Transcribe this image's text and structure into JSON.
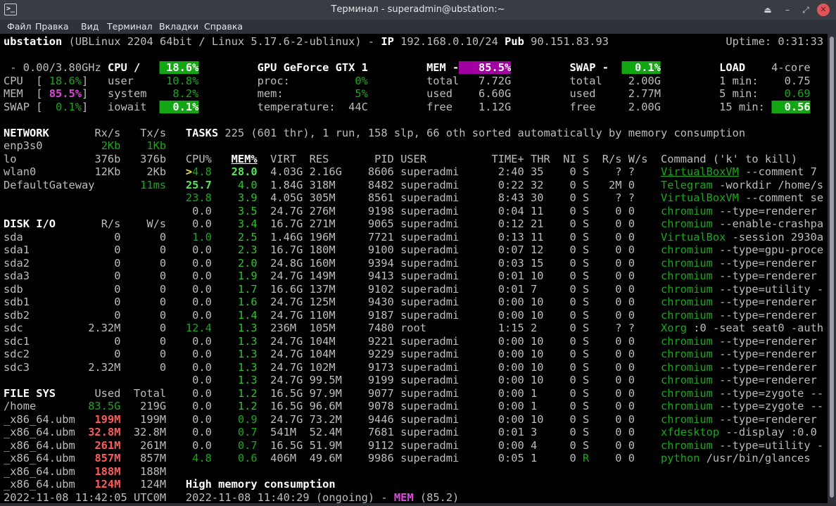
{
  "window": {
    "title": "Терминал - superadmin@ubstation:~",
    "icon": "terminal-icon",
    "buttons": [
      "keep-above-icon",
      "minimize-icon",
      "maximize-icon",
      "close-icon"
    ]
  },
  "menu": [
    "Файл",
    "Правка",
    "Вид",
    "Терминал",
    "Вкладки",
    "Справка"
  ],
  "header": {
    "host": "ubstation",
    "os": "(UBLinux 2204 64bit / Linux 5.17.6-2-ublinux) - ",
    "ip_label": "IP",
    "ip": "192.168.0.10/24",
    "pub_label": "Pub",
    "pub": "90.151.83.93",
    "uptime": "Uptime: 0:31:33"
  },
  "quicklook": {
    "freq": " - 0.00/3.80GHz",
    "rows": [
      {
        "label": "CPU",
        "value": "18.6%"
      },
      {
        "label": "MEM",
        "value": "85.5%"
      },
      {
        "label": "SWAP",
        "value": "0.1%"
      }
    ]
  },
  "cpu": {
    "title": "CPU /",
    "total": "18.6%",
    "rows": [
      {
        "label": "user",
        "value": "10.8%"
      },
      {
        "label": "system",
        "value": "8.2%"
      },
      {
        "label": "iowait",
        "value": "0.1%"
      }
    ]
  },
  "gpu": {
    "title": "GPU GeForce GTX 1",
    "rows": [
      {
        "label": "proc:",
        "value": "0%"
      },
      {
        "label": "mem:",
        "value": "5%"
      },
      {
        "label": "temperature:",
        "value": "44C"
      }
    ]
  },
  "mem": {
    "title": "MEM -",
    "total": "85.5%",
    "rows": [
      {
        "label": "total",
        "value": "7.72G"
      },
      {
        "label": "used",
        "value": "6.60G"
      },
      {
        "label": "free",
        "value": "1.12G"
      }
    ]
  },
  "swap": {
    "title": "SWAP -",
    "total": "0.1%",
    "rows": [
      {
        "label": "total",
        "value": "2.00G"
      },
      {
        "label": "used",
        "value": "2.77M"
      },
      {
        "label": "free",
        "value": "2.00G"
      }
    ]
  },
  "load": {
    "title": "LOAD",
    "cores": "4-core",
    "rows": [
      {
        "label": "1 min:",
        "value": "0.75"
      },
      {
        "label": "5 min:",
        "value": "0.69"
      },
      {
        "label": "15 min:",
        "value": "0.56"
      }
    ]
  },
  "network": {
    "title": "NETWORK",
    "rx": "Rx/s",
    "tx": "Tx/s",
    "rows": [
      {
        "name": "enp3s0",
        "rx": "2Kb",
        "tx": "1Kb",
        "hl": true
      },
      {
        "name": "lo",
        "rx": "376b",
        "tx": "376b"
      },
      {
        "name": "wlan0",
        "rx": "12Kb",
        "tx": "2Kb"
      }
    ],
    "gateway": {
      "name": "DefaultGateway",
      "value": "11ms"
    }
  },
  "disk": {
    "title": "DISK I/O",
    "r": "R/s",
    "w": "W/s",
    "rows": [
      [
        "sda",
        "0",
        "0"
      ],
      [
        "sda1",
        "0",
        "0"
      ],
      [
        "sda2",
        "0",
        "0"
      ],
      [
        "sda3",
        "0",
        "0"
      ],
      [
        "sdb",
        "0",
        "0"
      ],
      [
        "sdb1",
        "0",
        "0"
      ],
      [
        "sdb2",
        "0",
        "0"
      ],
      [
        "sdc",
        "2.32M",
        "0"
      ],
      [
        "sdc1",
        "0",
        "0"
      ],
      [
        "sdc2",
        "0",
        "0"
      ],
      [
        "sdc3",
        "2.32M",
        "0"
      ]
    ]
  },
  "fs": {
    "title": "FILE SYS",
    "used": "Used",
    "total": "Total",
    "rows": [
      {
        "name": "/home",
        "used": "83.5G",
        "total": "219G",
        "status": "ok"
      },
      {
        "name": "_x86_64.ubm",
        "used": "199M",
        "total": "199M",
        "status": "critical"
      },
      {
        "name": "_x86_64.ubm",
        "used": "32.8M",
        "total": "32.8M",
        "status": "critical"
      },
      {
        "name": "_x86_64.ubm",
        "used": "261M",
        "total": "261M",
        "status": "critical"
      },
      {
        "name": "_x86_64.ubm",
        "used": "857M",
        "total": "857M",
        "status": "critical"
      },
      {
        "name": "_x86_64.ubm",
        "used": "188M",
        "total": "188M",
        "status": "critical"
      },
      {
        "name": "_x86_64.ubm",
        "used": "124M",
        "total": "124M",
        "status": "critical"
      }
    ]
  },
  "clock": "2022-11-08 11:42:05 UTC0M",
  "tasks": {
    "label": "TASKS",
    "summary": "225 (601 thr), 1 run, 158 slp, 66 oth sorted automatically by memory consumption"
  },
  "processes": {
    "columns": [
      "CPU%",
      "MEM%",
      "VIRT",
      "RES",
      "PID",
      "USER",
      "TIME+",
      "THR",
      "NI",
      "S",
      "R/s",
      "W/s",
      "Command ('k' to kill)"
    ],
    "sorted_by": "MEM%",
    "rows": [
      {
        "cpu": "4.8",
        "cs": "ok",
        "sel": true,
        "mem": "28.0",
        "ms": "high",
        "virt": "4.03G",
        "res": "2.16G",
        "pid": "8606",
        "user": "superadmi",
        "time": "2:40",
        "thr": "35",
        "ni": "0",
        "s": "S",
        "rs": "?",
        "ws": "?",
        "name": "VirtualBoxVM",
        "args": " --comment 7"
      },
      {
        "cpu": "25.7",
        "cs": "high",
        "mem": "4.0",
        "ms": "ok",
        "virt": "1.84G",
        "res": "318M",
        "pid": "8482",
        "user": "superadmi",
        "time": "0:22",
        "thr": "32",
        "ni": "0",
        "s": "S",
        "rs": "2M",
        "ws": "0",
        "name": "Telegram",
        "args": " -workdir /home/s"
      },
      {
        "cpu": "23.8",
        "cs": "ok",
        "mem": "3.9",
        "ms": "ok",
        "virt": "4.05G",
        "res": "305M",
        "pid": "8561",
        "user": "superadmi",
        "time": "8:43",
        "thr": "30",
        "ni": "0",
        "s": "S",
        "rs": "?",
        "ws": "?",
        "name": "VirtualBoxVM",
        "args": " --comment se"
      },
      {
        "cpu": "0.0",
        "mem": "3.5",
        "ms": "ok",
        "virt": "24.7G",
        "res": "276M",
        "pid": "9198",
        "user": "superadmi",
        "time": "0:04",
        "thr": "11",
        "ni": "0",
        "s": "S",
        "rs": "0",
        "ws": "0",
        "name": "chromium",
        "args": " --type=renderer"
      },
      {
        "cpu": "0.0",
        "mem": "3.4",
        "ms": "ok",
        "virt": "16.7G",
        "res": "271M",
        "pid": "9065",
        "user": "superadmi",
        "time": "0:12",
        "thr": "21",
        "ni": "0",
        "s": "S",
        "rs": "0",
        "ws": "0",
        "name": "chromium",
        "args": " --enable-crashpa"
      },
      {
        "cpu": "1.0",
        "cs": "ok",
        "mem": "2.5",
        "ms": "ok",
        "virt": "1.46G",
        "res": "196M",
        "pid": "7721",
        "user": "superadmi",
        "time": "0:13",
        "thr": "11",
        "ni": "0",
        "s": "S",
        "rs": "0",
        "ws": "0",
        "name": "VirtualBox",
        "args": " -session 2930a"
      },
      {
        "cpu": "0.0",
        "mem": "2.3",
        "ms": "ok",
        "virt": "16.7G",
        "res": "180M",
        "pid": "9100",
        "user": "superadmi",
        "time": "0:07",
        "thr": "12",
        "ni": "0",
        "s": "S",
        "rs": "0",
        "ws": "0",
        "name": "chromium",
        "args": " --type=gpu-proce"
      },
      {
        "cpu": "0.0",
        "mem": "2.0",
        "ms": "ok",
        "virt": "24.8G",
        "res": "160M",
        "pid": "9394",
        "user": "superadmi",
        "time": "0:03",
        "thr": "15",
        "ni": "0",
        "s": "S",
        "rs": "0",
        "ws": "0",
        "name": "chromium",
        "args": " --type=renderer"
      },
      {
        "cpu": "0.0",
        "mem": "1.9",
        "ms": "ok",
        "virt": "24.7G",
        "res": "149M",
        "pid": "9413",
        "user": "superadmi",
        "time": "0:01",
        "thr": "10",
        "ni": "0",
        "s": "S",
        "rs": "0",
        "ws": "0",
        "name": "chromium",
        "args": " --type=renderer"
      },
      {
        "cpu": "0.0",
        "mem": "1.7",
        "ms": "ok",
        "virt": "16.6G",
        "res": "137M",
        "pid": "9102",
        "user": "superadmi",
        "time": "0:01",
        "thr": "7",
        "ni": "0",
        "s": "S",
        "rs": "0",
        "ws": "0",
        "name": "chromium",
        "args": " --type=utility -"
      },
      {
        "cpu": "0.0",
        "mem": "1.6",
        "ms": "ok",
        "virt": "24.7G",
        "res": "125M",
        "pid": "9430",
        "user": "superadmi",
        "time": "0:00",
        "thr": "10",
        "ni": "0",
        "s": "S",
        "rs": "0",
        "ws": "0",
        "name": "chromium",
        "args": " --type=renderer"
      },
      {
        "cpu": "0.0",
        "mem": "1.4",
        "ms": "ok",
        "virt": "24.7G",
        "res": "110M",
        "pid": "9187",
        "user": "superadmi",
        "time": "0:00",
        "thr": "10",
        "ni": "0",
        "s": "S",
        "rs": "0",
        "ws": "0",
        "name": "chromium",
        "args": " --type=renderer"
      },
      {
        "cpu": "12.4",
        "cs": "ok",
        "mem": "1.3",
        "ms": "ok",
        "virt": "236M",
        "res": "105M",
        "pid": "7480",
        "user": "root",
        "time": "1:15",
        "thr": "2",
        "ni": "0",
        "s": "S",
        "rs": "?",
        "ws": "?",
        "name": "Xorg",
        "args": " :0 -seat seat0 -auth"
      },
      {
        "cpu": "0.0",
        "mem": "1.3",
        "ms": "ok",
        "virt": "24.7G",
        "res": "104M",
        "pid": "9221",
        "user": "superadmi",
        "time": "0:00",
        "thr": "10",
        "ni": "0",
        "s": "S",
        "rs": "0",
        "ws": "0",
        "name": "chromium",
        "args": " --type=renderer"
      },
      {
        "cpu": "0.0",
        "mem": "1.3",
        "ms": "ok",
        "virt": "24.7G",
        "res": "104M",
        "pid": "9229",
        "user": "superadmi",
        "time": "0:00",
        "thr": "10",
        "ni": "0",
        "s": "S",
        "rs": "0",
        "ws": "0",
        "name": "chromium",
        "args": " --type=renderer"
      },
      {
        "cpu": "0.0",
        "mem": "1.3",
        "ms": "ok",
        "virt": "24.7G",
        "res": "102M",
        "pid": "9173",
        "user": "superadmi",
        "time": "0:00",
        "thr": "10",
        "ni": "0",
        "s": "S",
        "rs": "0",
        "ws": "0",
        "name": "chromium",
        "args": " --type=renderer"
      },
      {
        "cpu": "0.0",
        "mem": "1.3",
        "ms": "ok",
        "virt": "24.7G",
        "res": "99.5M",
        "pid": "9199",
        "user": "superadmi",
        "time": "0:00",
        "thr": "10",
        "ni": "0",
        "s": "S",
        "rs": "0",
        "ws": "0",
        "name": "chromium",
        "args": " --type=renderer"
      },
      {
        "cpu": "0.0",
        "mem": "1.2",
        "ms": "ok",
        "virt": "16.5G",
        "res": "97.9M",
        "pid": "9077",
        "user": "superadmi",
        "time": "0:00",
        "thr": "1",
        "ni": "0",
        "s": "S",
        "rs": "0",
        "ws": "0",
        "name": "chromium",
        "args": " --type=zygote --"
      },
      {
        "cpu": "0.0",
        "mem": "1.2",
        "ms": "ok",
        "virt": "16.5G",
        "res": "96.6M",
        "pid": "9078",
        "user": "superadmi",
        "time": "0:00",
        "thr": "1",
        "ni": "0",
        "s": "S",
        "rs": "0",
        "ws": "0",
        "name": "chromium",
        "args": " --type=zygote --"
      },
      {
        "cpu": "0.0",
        "mem": "0.9",
        "ms": "low",
        "virt": "24.7G",
        "res": "73.2M",
        "pid": "9446",
        "user": "superadmi",
        "time": "0:00",
        "thr": "10",
        "ni": "0",
        "s": "S",
        "rs": "0",
        "ws": "0",
        "name": "chromium",
        "args": " --type=renderer"
      },
      {
        "cpu": "0.0",
        "mem": "0.7",
        "ms": "low",
        "virt": "541M",
        "res": "52.4M",
        "pid": "7681",
        "user": "superadmi",
        "time": "0:01",
        "thr": "3",
        "ni": "0",
        "s": "S",
        "rs": "0",
        "ws": "0",
        "name": "xfdesktop",
        "args": " --display :0.0"
      },
      {
        "cpu": "0.0",
        "mem": "0.7",
        "ms": "low",
        "virt": "16.5G",
        "res": "51.9M",
        "pid": "9112",
        "user": "superadmi",
        "time": "0:00",
        "thr": "4",
        "ni": "0",
        "s": "S",
        "rs": "0",
        "ws": "0",
        "name": "chromium",
        "args": " --type=utility -"
      },
      {
        "cpu": "4.8",
        "cs": "ok",
        "mem": "0.6",
        "ms": "low",
        "virt": "406M",
        "res": "49.6M",
        "pid": "9986",
        "user": "superadmi",
        "time": "0:05",
        "thr": "1",
        "ni": "0",
        "s": "R",
        "rs": "0",
        "ws": "0",
        "name": "python",
        "args": " /usr/bin/glances"
      }
    ]
  },
  "alert": {
    "title": "High memory consumption",
    "time": "2022-11-08 11:40:29 (ongoing) - ",
    "metric": "MEM",
    "value": " (85.2)"
  },
  "colors": {
    "ok": "#1aa81a",
    "high": "#55ea55",
    "critical": "#ff5a5a",
    "mem_bg": "#a300a3",
    "ok_bg": "#12a612"
  }
}
